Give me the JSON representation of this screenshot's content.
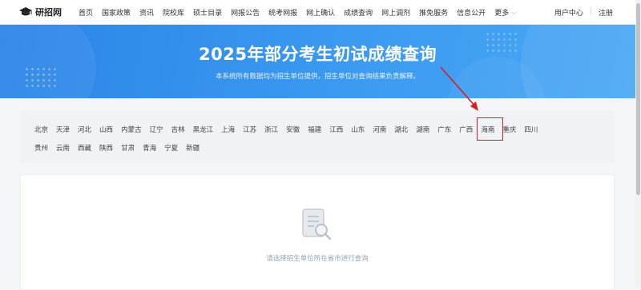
{
  "logo": {
    "text": "研招网",
    "icon": "graduation-cap-icon"
  },
  "nav": {
    "items": [
      "首页",
      "国家政策",
      "资讯",
      "院校库",
      "硕士目录",
      "网报公告",
      "统考网报",
      "网上确认",
      "成绩查询",
      "网上调剂",
      "推免服务",
      "信息公开"
    ],
    "more": "更多"
  },
  "user": {
    "center": "用户中心",
    "sep": "|",
    "register": "注册"
  },
  "banner": {
    "title": "2025年部分考生初试成绩查询",
    "subtitle": "本系统所有数据均为招生单位提供，招生单位对查询结果负责解释。"
  },
  "provinces": {
    "row1": [
      "北京",
      "天津",
      "河北",
      "山西",
      "内蒙古",
      "辽宁",
      "吉林",
      "黑龙江",
      "上海",
      "江苏",
      "浙江",
      "安徽",
      "福建",
      "江西",
      "山东",
      "河南",
      "湖北",
      "湖南",
      "广东",
      "广西",
      "海南",
      "重庆",
      "四川"
    ],
    "row2": [
      "贵州",
      "云南",
      "西藏",
      "陕西",
      "甘肃",
      "青海",
      "宁夏",
      "新疆"
    ],
    "highlighted": "广东"
  },
  "result": {
    "empty_text": "请选择招生单位所在省市进行查询",
    "icon": "document-search-icon"
  },
  "colors": {
    "banner": "#3a98f0",
    "highlight": "#d71f1f"
  }
}
